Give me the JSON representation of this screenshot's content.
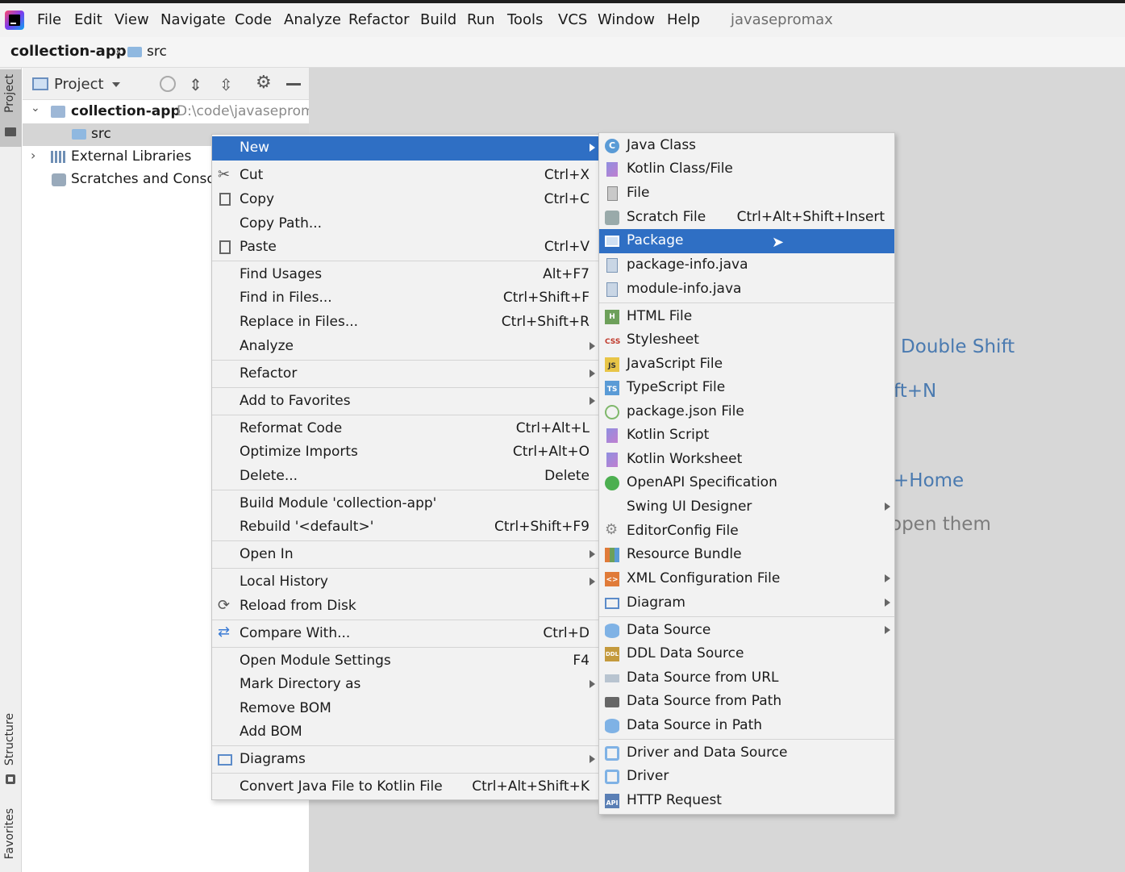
{
  "menubar": {
    "items": [
      "File",
      "Edit",
      "View",
      "Navigate",
      "Code",
      "Analyze",
      "Refactor",
      "Build",
      "Run",
      "Tools",
      "VCS",
      "Window",
      "Help"
    ],
    "project_name": "javasepromax"
  },
  "breadcrumb": {
    "root": "collection-app",
    "child": "src"
  },
  "side_tabs": {
    "project": "Project",
    "structure": "Structure",
    "favorites": "Favorites"
  },
  "project_panel": {
    "title": "Project",
    "tree": [
      {
        "label": "collection-app",
        "path": "D:\\code\\javaseprom"
      },
      {
        "label": "src"
      },
      {
        "label": "External Libraries"
      },
      {
        "label": "Scratches and Consol"
      }
    ]
  },
  "editor_hints": [
    ": Double Shift",
    "ft+N",
    "+Home",
    "open them"
  ],
  "context_menu": [
    {
      "label": "New",
      "shortcut": "",
      "submenu": true,
      "selected": true
    },
    {
      "label": "Cut",
      "shortcut": "Ctrl+X",
      "icon": "scissors-icon"
    },
    {
      "label": "Copy",
      "shortcut": "Ctrl+C",
      "icon": "copy-icon"
    },
    {
      "label": "Copy Path...",
      "shortcut": ""
    },
    {
      "label": "Paste",
      "shortcut": "Ctrl+V",
      "icon": "paste-icon"
    },
    {
      "label": "Find Usages",
      "shortcut": "Alt+F7"
    },
    {
      "label": "Find in Files...",
      "shortcut": "Ctrl+Shift+F"
    },
    {
      "label": "Replace in Files...",
      "shortcut": "Ctrl+Shift+R"
    },
    {
      "label": "Analyze",
      "shortcut": "",
      "submenu": true
    },
    {
      "label": "Refactor",
      "shortcut": "",
      "submenu": true
    },
    {
      "label": "Add to Favorites",
      "shortcut": "",
      "submenu": true
    },
    {
      "label": "Reformat Code",
      "shortcut": "Ctrl+Alt+L"
    },
    {
      "label": "Optimize Imports",
      "shortcut": "Ctrl+Alt+O"
    },
    {
      "label": "Delete...",
      "shortcut": "Delete"
    },
    {
      "label": "Build Module 'collection-app'",
      "shortcut": ""
    },
    {
      "label": "Rebuild '<default>'",
      "shortcut": "Ctrl+Shift+F9"
    },
    {
      "label": "Open In",
      "shortcut": "",
      "submenu": true
    },
    {
      "label": "Local History",
      "shortcut": "",
      "submenu": true
    },
    {
      "label": "Reload from Disk",
      "shortcut": "",
      "icon": "reload-icon"
    },
    {
      "label": "Compare With...",
      "shortcut": "Ctrl+D",
      "icon": "compare-icon"
    },
    {
      "label": "Open Module Settings",
      "shortcut": "F4"
    },
    {
      "label": "Mark Directory as",
      "shortcut": "",
      "submenu": true
    },
    {
      "label": "Remove BOM",
      "shortcut": ""
    },
    {
      "label": "Add BOM",
      "shortcut": ""
    },
    {
      "label": "Diagrams",
      "shortcut": "",
      "submenu": true,
      "icon": "diagram-icon"
    },
    {
      "label": "Convert Java File to Kotlin File",
      "shortcut": "Ctrl+Alt+Shift+K"
    }
  ],
  "new_submenu": [
    {
      "label": "Java Class",
      "icon": "java-class-icon"
    },
    {
      "label": "Kotlin Class/File",
      "icon": "kotlin-file-icon"
    },
    {
      "label": "File",
      "icon": "file-icon"
    },
    {
      "label": "Scratch File",
      "shortcut": "Ctrl+Alt+Shift+Insert",
      "icon": "scratch-file-icon"
    },
    {
      "label": "Package",
      "selected": true,
      "icon": "package-icon"
    },
    {
      "label": "package-info.java",
      "icon": "java-file-icon"
    },
    {
      "label": "module-info.java",
      "icon": "java-file-icon"
    },
    {
      "label": "HTML File",
      "icon": "html-file-icon"
    },
    {
      "label": "Stylesheet",
      "icon": "css-file-icon"
    },
    {
      "label": "JavaScript File",
      "icon": "js-file-icon"
    },
    {
      "label": "TypeScript File",
      "icon": "ts-file-icon"
    },
    {
      "label": "package.json File",
      "icon": "nodejs-icon"
    },
    {
      "label": "Kotlin Script",
      "icon": "kotlin-file-icon"
    },
    {
      "label": "Kotlin Worksheet",
      "icon": "kotlin-file-icon"
    },
    {
      "label": "OpenAPI Specification",
      "icon": "openapi-icon"
    },
    {
      "label": "Swing UI Designer",
      "submenu": true
    },
    {
      "label": "EditorConfig File",
      "icon": "gear-icon"
    },
    {
      "label": "Resource Bundle",
      "icon": "resource-bundle-icon"
    },
    {
      "label": "XML Configuration File",
      "submenu": true,
      "icon": "xml-file-icon"
    },
    {
      "label": "Diagram",
      "submenu": true,
      "icon": "diagram-icon"
    },
    {
      "label": "Data Source",
      "submenu": true,
      "icon": "database-icon"
    },
    {
      "label": "DDL Data Source",
      "icon": "ddl-icon"
    },
    {
      "label": "Data Source from URL",
      "icon": "database-url-icon"
    },
    {
      "label": "Data Source from Path",
      "icon": "folder-icon"
    },
    {
      "label": "Data Source in Path",
      "icon": "database-icon"
    },
    {
      "label": "Driver and Data Source",
      "icon": "driver-icon"
    },
    {
      "label": "Driver",
      "icon": "driver-icon"
    },
    {
      "label": "HTTP Request",
      "icon": "api-icon"
    }
  ],
  "colors": {
    "selection": "#2f6fc4",
    "menu_bg": "#f2f2f2",
    "editor_bg": "#d7d7d7",
    "hint_blue": "#4a7ab0"
  }
}
